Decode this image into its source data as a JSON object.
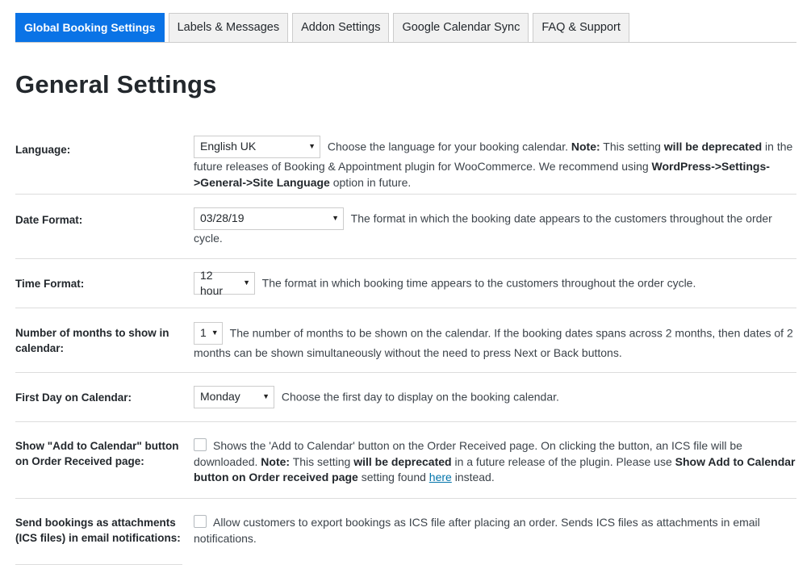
{
  "tabs": [
    {
      "label": "Global Booking Settings",
      "active": true
    },
    {
      "label": "Labels & Messages"
    },
    {
      "label": "Addon Settings"
    },
    {
      "label": "Google Calendar Sync"
    },
    {
      "label": "FAQ & Support"
    }
  ],
  "page_title": "General Settings",
  "settings": {
    "language": {
      "label": "Language:",
      "value": "English UK",
      "desc1": " Choose the language for your booking calendar. ",
      "note": "Note:",
      "desc2": " This setting ",
      "deprecated": "will be deprecated",
      "desc3": " in the future releases of Booking & Appointment plugin for WooCommerce. We recommend using ",
      "path": "WordPress->Settings->General->Site Language",
      "desc4": " option in future."
    },
    "date_format": {
      "label": "Date Format:",
      "value": "03/28/19",
      "desc": " The format in which the booking date appears to the customers throughout the order cycle."
    },
    "time_format": {
      "label": "Time Format:",
      "value": "12 hour",
      "desc": " The format in which booking time appears to the customers throughout the order cycle."
    },
    "months": {
      "label": "Number of months to show in calendar:",
      "value": "1",
      "desc": " The number of months to be shown on the calendar. If the booking dates spans across 2 months, then dates of 2 months can be shown simultaneously without the need to press Next or Back buttons."
    },
    "first_day": {
      "label": "First Day on Calendar:",
      "value": "Monday",
      "desc": " Choose the first day to display on the booking calendar."
    },
    "add_to_calendar": {
      "label": "Show \"Add to Calendar\" button on Order Received page:",
      "checked": false,
      "desc1": "Shows the 'Add to Calendar' button on the Order Received page. On clicking the button, an ICS file will be downloaded. ",
      "note": "Note:",
      "desc2": " This setting ",
      "deprecated": "will be deprecated",
      "desc3": " in a future release of the plugin. Please use ",
      "bold_setting": "Show Add to Calendar button on Order received page",
      "desc4": " setting found ",
      "link": "here",
      "desc5": " instead."
    },
    "attachments": {
      "label": "Send bookings as attachments (ICS files) in email notifications:",
      "checked": false,
      "desc": "Allow customers to export bookings as ICS file after placing an order. Sends ICS files as attachments in email notifications."
    }
  }
}
